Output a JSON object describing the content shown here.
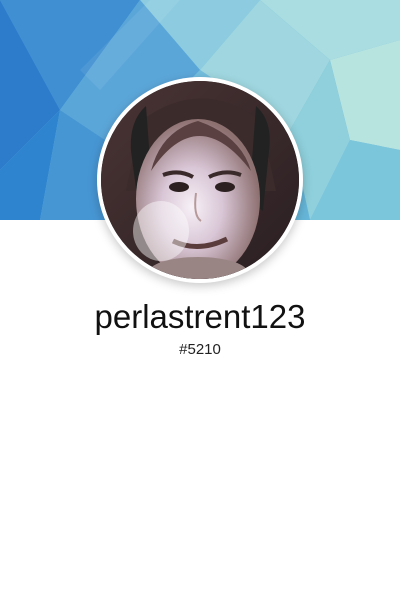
{
  "profile": {
    "username": "perlastrent123",
    "discriminator": "#5210"
  },
  "colors": {
    "banner_base": "#6fb7d8",
    "banner_accent_dark": "#2f7fc9",
    "banner_accent_light": "#b5e2e0",
    "avatar_border": "#ffffff",
    "username_text": "#111111"
  },
  "icons": {
    "avatar": "user-photo"
  }
}
